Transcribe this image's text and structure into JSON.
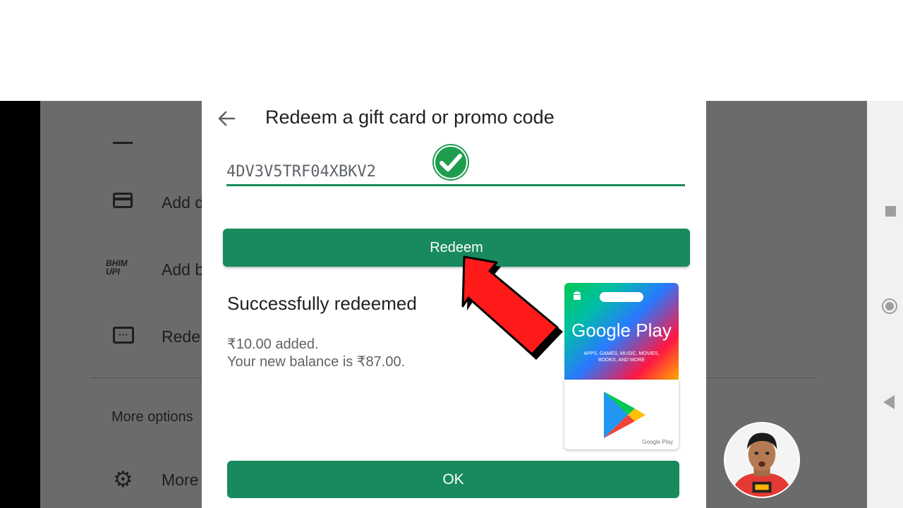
{
  "background_menu": {
    "items": [
      {
        "label": "Add d"
      },
      {
        "label": "Add b"
      },
      {
        "label": "Rede"
      },
      {
        "label": "More options"
      },
      {
        "label": "More"
      }
    ],
    "upi_logo_text": "BHIM UPI"
  },
  "dialog": {
    "title": "Redeem a gift card or promo code",
    "code_value": "4DV3V5TRF04XBKV2",
    "redeem_label": "Redeem",
    "success_title": "Successfully redeemed",
    "added_text": "₹10.00 added.",
    "balance_text": "Your new balance is ₹87.00.",
    "ok_label": "OK",
    "gift_card": {
      "brand": "Google Play",
      "subtitle": "APPS, GAMES, MUSIC, MOVIES, BOOKS, AND MORE",
      "footer": "Google Play"
    }
  },
  "colors": {
    "accent": "#188a5e",
    "scrim": "#6b6b6b",
    "pointer_arrow": "#ff1a1a"
  }
}
